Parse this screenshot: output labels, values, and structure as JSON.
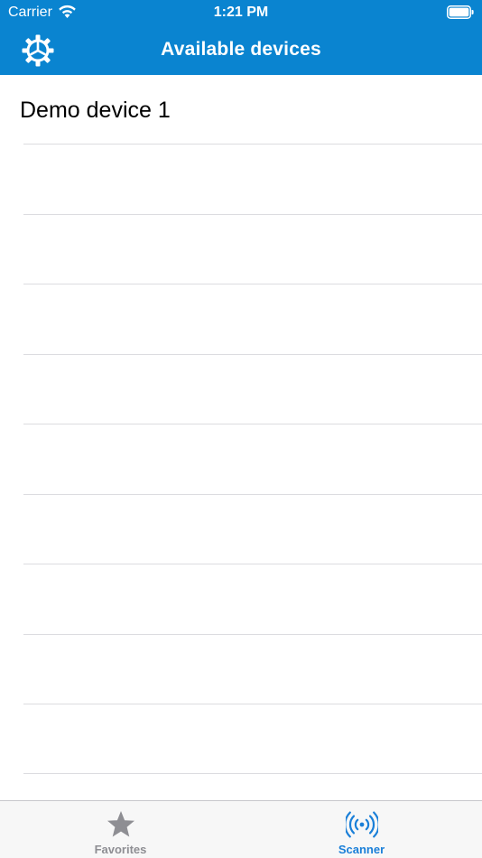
{
  "status_bar": {
    "carrier": "Carrier",
    "time": "1:21 PM",
    "wifi_icon": "wifi-icon",
    "battery_icon": "battery-full-icon"
  },
  "nav_bar": {
    "title": "Available devices",
    "settings_icon": "gear-icon",
    "background_color": "#0a84d0"
  },
  "devices": [
    {
      "name": "Demo device 1"
    }
  ],
  "tab_bar": {
    "tabs": [
      {
        "label": "Favorites",
        "icon": "star-icon",
        "selected": false,
        "color": "#8e8e93"
      },
      {
        "label": "Scanner",
        "icon": "broadcast-icon",
        "selected": true,
        "color": "#1a7fd8"
      }
    ]
  }
}
